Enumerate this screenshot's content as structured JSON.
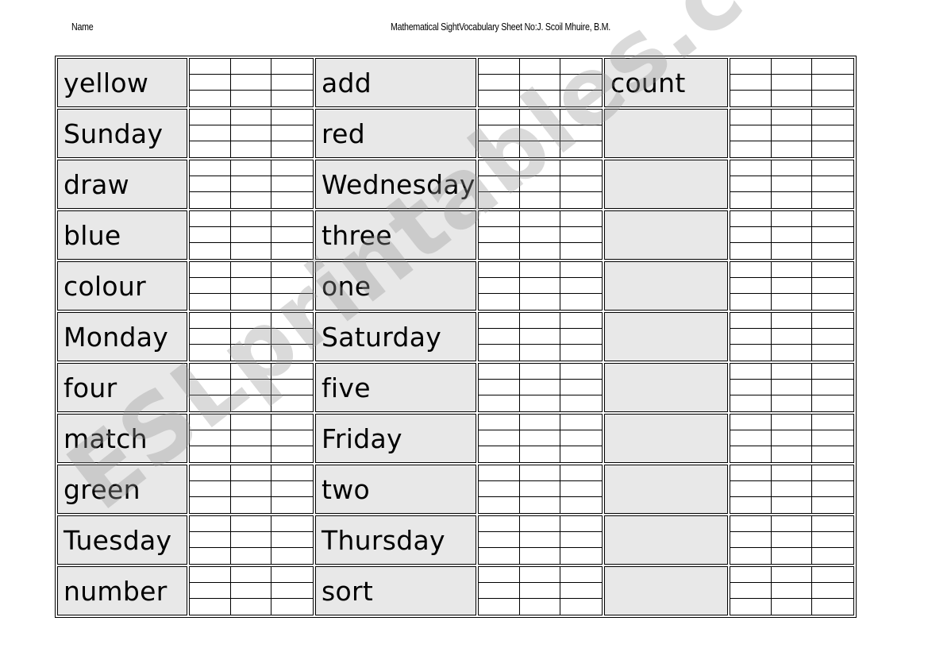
{
  "header": {
    "name_label": "Name",
    "title": "Mathematical SightVocabulary Sheet No:J.  Scoil Mhuire,  B.M."
  },
  "columns": [
    {
      "words": [
        "yellow",
        "Sunday",
        "draw",
        "blue",
        "colour",
        "Monday",
        "four",
        "match",
        "green",
        "Tuesday",
        "number"
      ]
    },
    {
      "words": [
        "add",
        "red",
        "Wednesday",
        "three",
        "one",
        "Saturday",
        "five",
        "Friday",
        "two",
        "Thursday",
        "sort"
      ]
    },
    {
      "words": [
        "count",
        "",
        "",
        "",
        "",
        "",
        "",
        "",
        "",
        "",
        ""
      ]
    }
  ],
  "watermark": "ESLprintables.com"
}
